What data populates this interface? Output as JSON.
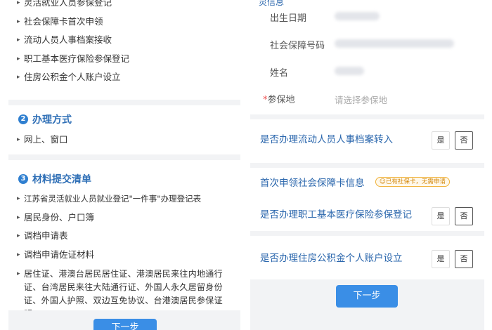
{
  "left": {
    "items_top": [
      "灵活就业人员参保登记",
      "社会保障卡首次申领",
      "流动人员人事档案接收",
      "职工基本医疗保险参保登记",
      "住房公积金个人账户设立"
    ],
    "section2": {
      "num": "2",
      "title": "办理方式"
    },
    "items_mode": [
      "网上、窗口"
    ],
    "section3": {
      "num": "3",
      "title": "材料提交清单"
    },
    "items_materials": [
      "江苏省灵活就业人员就业登记\"一件事\"办理登记表",
      "居民身份、户口簿",
      "调档申请表",
      "调档申请佐证材料",
      "居住证、港澳台居民居住证、港澳居民来往内地通行证、台湾居民来往大陆通行证、外国人永久居留身份证、外国人护照、双边互免协议、台港澳居民参保证明"
    ],
    "next_button": "下一步"
  },
  "right": {
    "header_stub": "灵信息",
    "fields": [
      {
        "label": "出生日期"
      },
      {
        "label": "社会保障号码"
      },
      {
        "label": "姓名"
      }
    ],
    "insured_place": {
      "required_mark": "*",
      "label": "参保地",
      "placeholder": "请选择参保地"
    },
    "questions": [
      {
        "text": "是否办理流动人员人事档案转入",
        "yes": "是",
        "no": "否"
      },
      {
        "text": "是否办理职工基本医疗保险参保登记",
        "yes": "是",
        "no": "否"
      },
      {
        "text": "是否办理住房公积金个人账户设立",
        "yes": "是",
        "no": "否"
      }
    ],
    "card_info": {
      "title": "首次申领社会保障卡信息",
      "badge": "☺已有社保卡，无需申请"
    },
    "next_button": "下一步"
  }
}
